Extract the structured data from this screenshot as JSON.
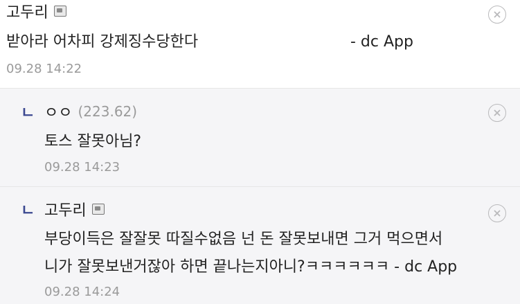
{
  "comments": [
    {
      "author": "고두리",
      "ip": "",
      "body_lines": [
        "받아라 어차피 강제징수당한다",
        "- dc App"
      ],
      "time": "09.28 14:22"
    },
    {
      "reply_marker": "ㄴ",
      "author": "ㅇㅇ",
      "ip": "(223.62)",
      "body_lines": [
        "토스 잘못아님?"
      ],
      "time": "09.28 14:23"
    },
    {
      "reply_marker": "ㄴ",
      "author": "고두리",
      "ip": "",
      "body_lines": [
        "부당이득은 잘잘못 따질수없음 넌 돈 잘못보내면 그거 먹으면서",
        "니가 잘못보낸거잖아 하면 끝나는지아니?ㅋㅋㅋㅋㅋㅋ - dc App"
      ],
      "time": "09.28 14:24"
    }
  ],
  "icons": {
    "badge": "gallery-badge-icon",
    "delete": "delete-circle-x-icon"
  },
  "colors": {
    "reply_marker": "#3b4890",
    "meta_text": "#9a9a9a",
    "reply_bg": "#f5f5f7"
  }
}
